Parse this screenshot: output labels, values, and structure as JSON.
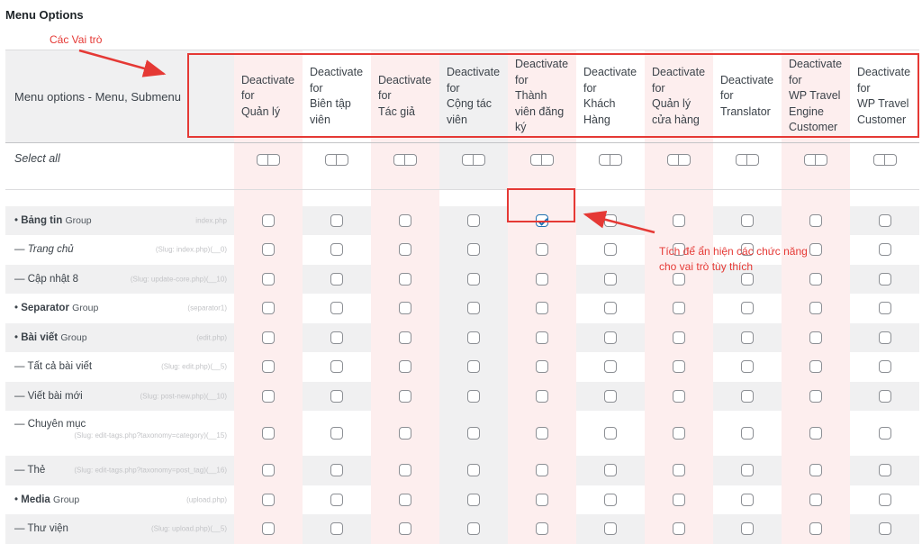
{
  "page": {
    "title": "Menu Options"
  },
  "annotations": {
    "roles": "Các Vai trò",
    "tick_line1": "Tích để ẩn hiện các chức năng",
    "tick_line2": "cho vai trò tùy thích",
    "color": "#e53935"
  },
  "table": {
    "first_header": "Menu options - Menu, Submenu",
    "role_columns": [
      {
        "lines": [
          "Deactivate",
          "for",
          "Quản lý"
        ]
      },
      {
        "lines": [
          "Deactivate",
          "for",
          "Biên tập",
          "viên"
        ]
      },
      {
        "lines": [
          "Deactivate",
          "for",
          "Tác giả"
        ]
      },
      {
        "lines": [
          "Deactivate",
          "for",
          "Cộng tác",
          "viên"
        ]
      },
      {
        "lines": [
          "Deactivate",
          "for",
          "Thành",
          "viên đăng",
          "ký"
        ]
      },
      {
        "lines": [
          "Deactivate",
          "for",
          "Khách",
          "Hàng"
        ]
      },
      {
        "lines": [
          "Deactivate",
          "for",
          "Quản lý",
          "cửa hàng"
        ]
      },
      {
        "lines": [
          "Deactivate",
          "for",
          "Translator"
        ]
      },
      {
        "lines": [
          "Deactivate",
          "for",
          "WP Travel",
          "Engine",
          "Customer"
        ]
      },
      {
        "lines": [
          "Deactivate",
          "for",
          "WP Travel",
          "Customer"
        ]
      }
    ],
    "select_all_label": "Select all",
    "rows": [
      {
        "bullet": "• ",
        "name": "Bảng tin",
        "group": "Group",
        "slug": "index.php",
        "bold": true,
        "shaded": true,
        "checked_col": 4
      },
      {
        "bullet": "— ",
        "name": "Trang chủ",
        "slug": "(Slug: index.php)(__0)",
        "italic": true
      },
      {
        "bullet": "— ",
        "name": "Cập nhật 8",
        "slug": "(Slug: update-core.php)(__10)",
        "shaded": true
      },
      {
        "bullet": "• ",
        "name": "Separator",
        "group": "Group",
        "slug": "(separator1)",
        "bold": true
      },
      {
        "bullet": "• ",
        "name": "Bài viết",
        "group": "Group",
        "slug": "(edit.php)",
        "bold": true,
        "shaded": true
      },
      {
        "bullet": "— ",
        "name": "Tất cả bài viết",
        "slug": "(Slug: edit.php)(__5)"
      },
      {
        "bullet": "— ",
        "name": "Viết bài mới",
        "slug": "(Slug: post-new.php)(__10)",
        "shaded": true
      },
      {
        "bullet": "— ",
        "name": "Chuyên mục",
        "slug": "(Slug: edit-tags.php?taxonomy=category)(__15)",
        "tall": true
      },
      {
        "bullet": "— ",
        "name": "Thẻ",
        "slug": "(Slug: edit-tags.php?taxonomy=post_tag)(__16)",
        "shaded": true
      },
      {
        "bullet": "• ",
        "name": "Media",
        "group": "Group",
        "slug": "(upload.php)",
        "bold": true
      },
      {
        "bullet": "— ",
        "name": "Thư viện",
        "slug": "(Slug: upload.php)(__5)",
        "shaded": true
      }
    ]
  }
}
